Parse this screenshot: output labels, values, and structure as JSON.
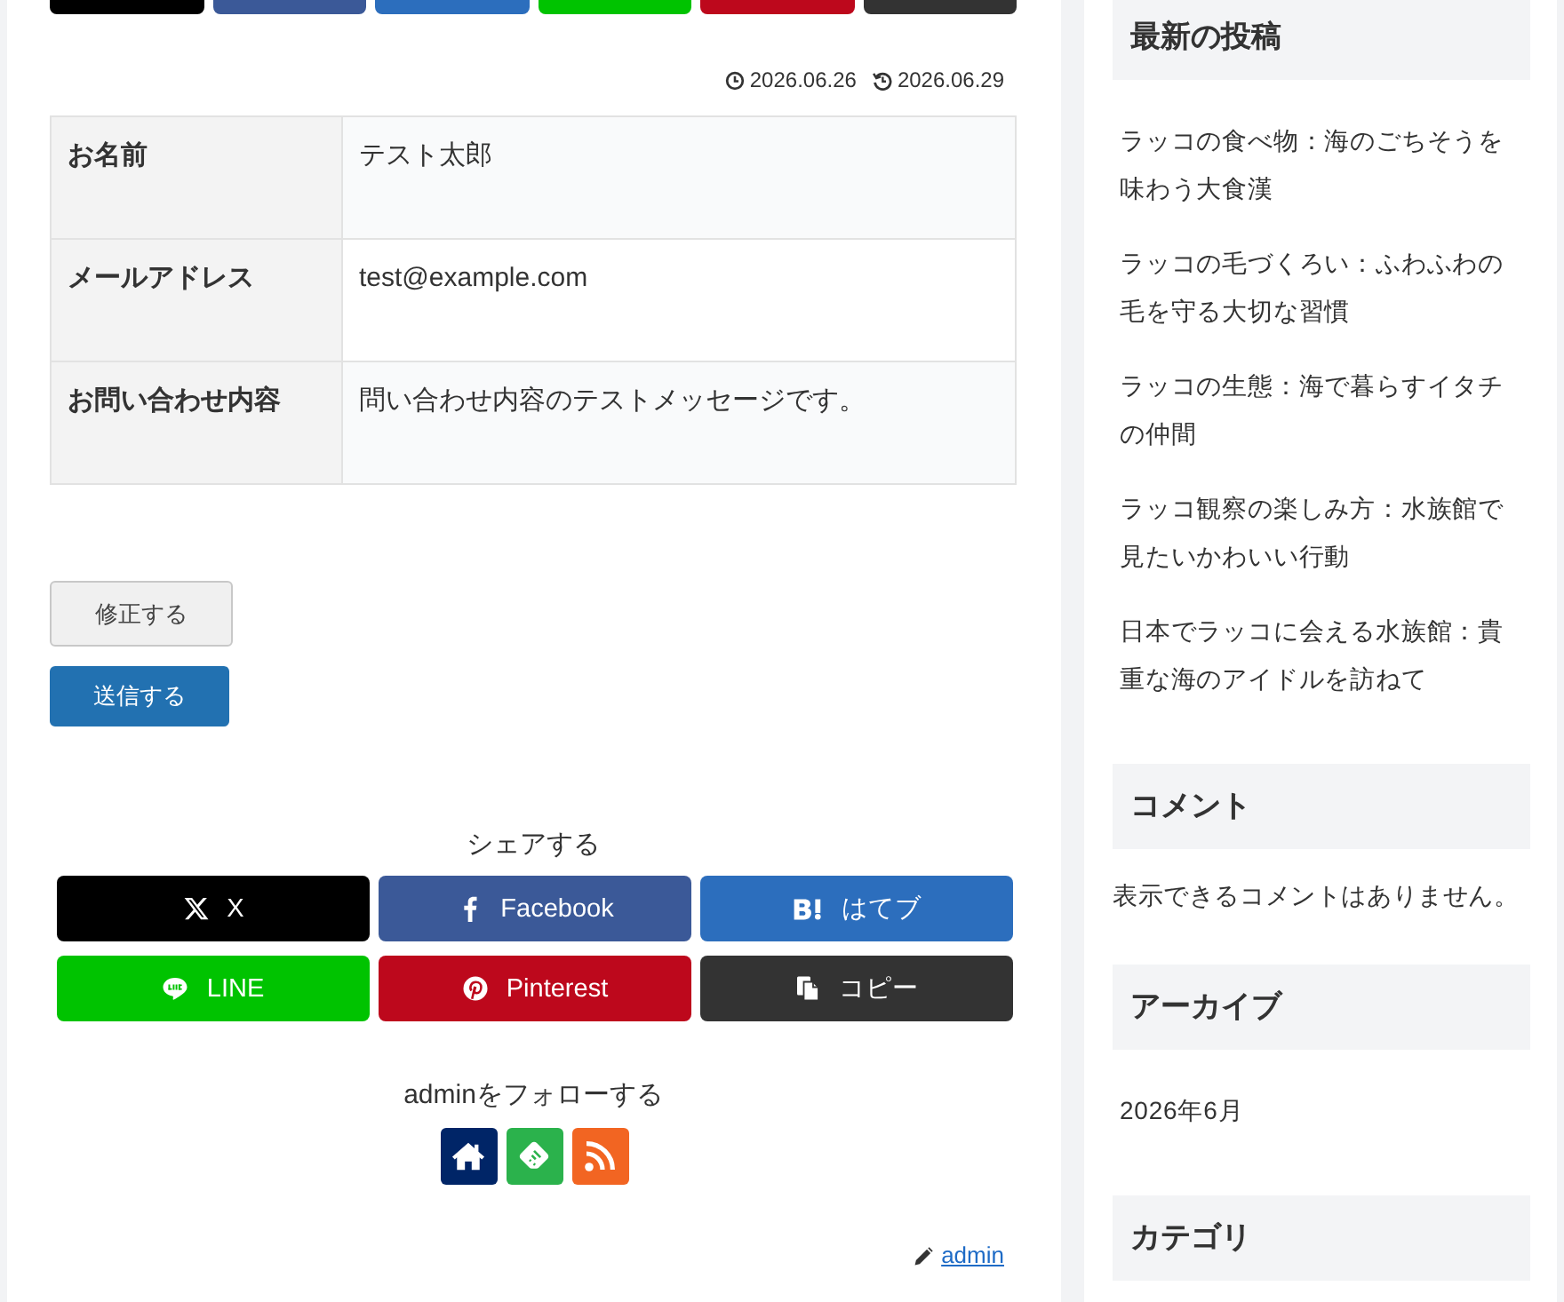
{
  "top_share_buttons": [
    {
      "kind": "x"
    },
    {
      "kind": "facebook"
    },
    {
      "kind": "hatena"
    },
    {
      "kind": "line"
    },
    {
      "kind": "pinterest"
    },
    {
      "kind": "copy"
    }
  ],
  "post_dates": {
    "published": "2026.06.26",
    "updated": "2026.06.29"
  },
  "confirm_table": {
    "rows": [
      {
        "label": "お名前",
        "value": "テスト太郎"
      },
      {
        "label": "メールアドレス",
        "value": "test@example.com"
      },
      {
        "label": "お問い合わせ内容",
        "value": "問い合わせ内容のテストメッセージです。"
      }
    ]
  },
  "form_buttons": [
    {
      "label": "修正する",
      "kind": "secondary"
    },
    {
      "label": "送信する",
      "kind": "primary"
    }
  ],
  "share": {
    "title": "シェアする",
    "buttons": [
      {
        "label": "X",
        "kind": "x"
      },
      {
        "label": "Facebook",
        "kind": "facebook"
      },
      {
        "label": "はてブ",
        "kind": "hatena"
      },
      {
        "label": "LINE",
        "kind": "line"
      },
      {
        "label": "Pinterest",
        "kind": "pinterest"
      },
      {
        "label": "コピー",
        "kind": "copy"
      }
    ]
  },
  "follow": {
    "title": "adminをフォローする",
    "buttons": [
      {
        "kind": "home"
      },
      {
        "kind": "feedly"
      },
      {
        "kind": "rss"
      }
    ]
  },
  "author": {
    "name": "admin"
  },
  "sidebar": {
    "widgets": [
      {
        "kind": "list",
        "title": "最新の投稿",
        "items": [
          "ラッコの食べ物：海のごちそうを味わう大食漢",
          "ラッコの毛づくろい：ふわふわの毛を守る大切な習慣",
          "ラッコの生態：海で暮らすイタチの仲間",
          "ラッコ観察の楽しみ方：水族館で見たいかわいい行動",
          "日本でラッコに会える水族館：貴重な海のアイドルを訪ねて"
        ]
      },
      {
        "kind": "text",
        "title": "コメント",
        "text": "表示できるコメントはありません。"
      },
      {
        "kind": "list",
        "title": "アーカイブ",
        "items": [
          "2026年6月"
        ]
      },
      {
        "kind": "heading",
        "title": "カテゴリ"
      }
    ]
  }
}
